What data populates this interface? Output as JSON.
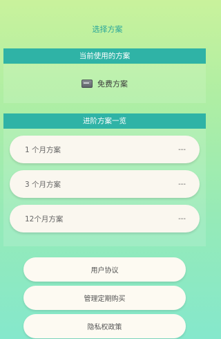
{
  "header": {
    "title": "选择方案"
  },
  "current": {
    "section_title": "当前使用的方案",
    "icon": "card-icon",
    "plan_label": "免费方案"
  },
  "plans": {
    "section_title": "进阶方案一览",
    "items": [
      {
        "name": "1 个月方案",
        "price": "---"
      },
      {
        "name": "3 个月方案",
        "price": "---"
      },
      {
        "name": "12个月方案",
        "price": "---"
      }
    ]
  },
  "links": {
    "user_agreement": "用户协议",
    "manage_subscription": "管理定期购买",
    "privacy_policy": "隐私权政策"
  },
  "colors": {
    "accent": "#2fb3a6",
    "title": "#2aa69a"
  }
}
